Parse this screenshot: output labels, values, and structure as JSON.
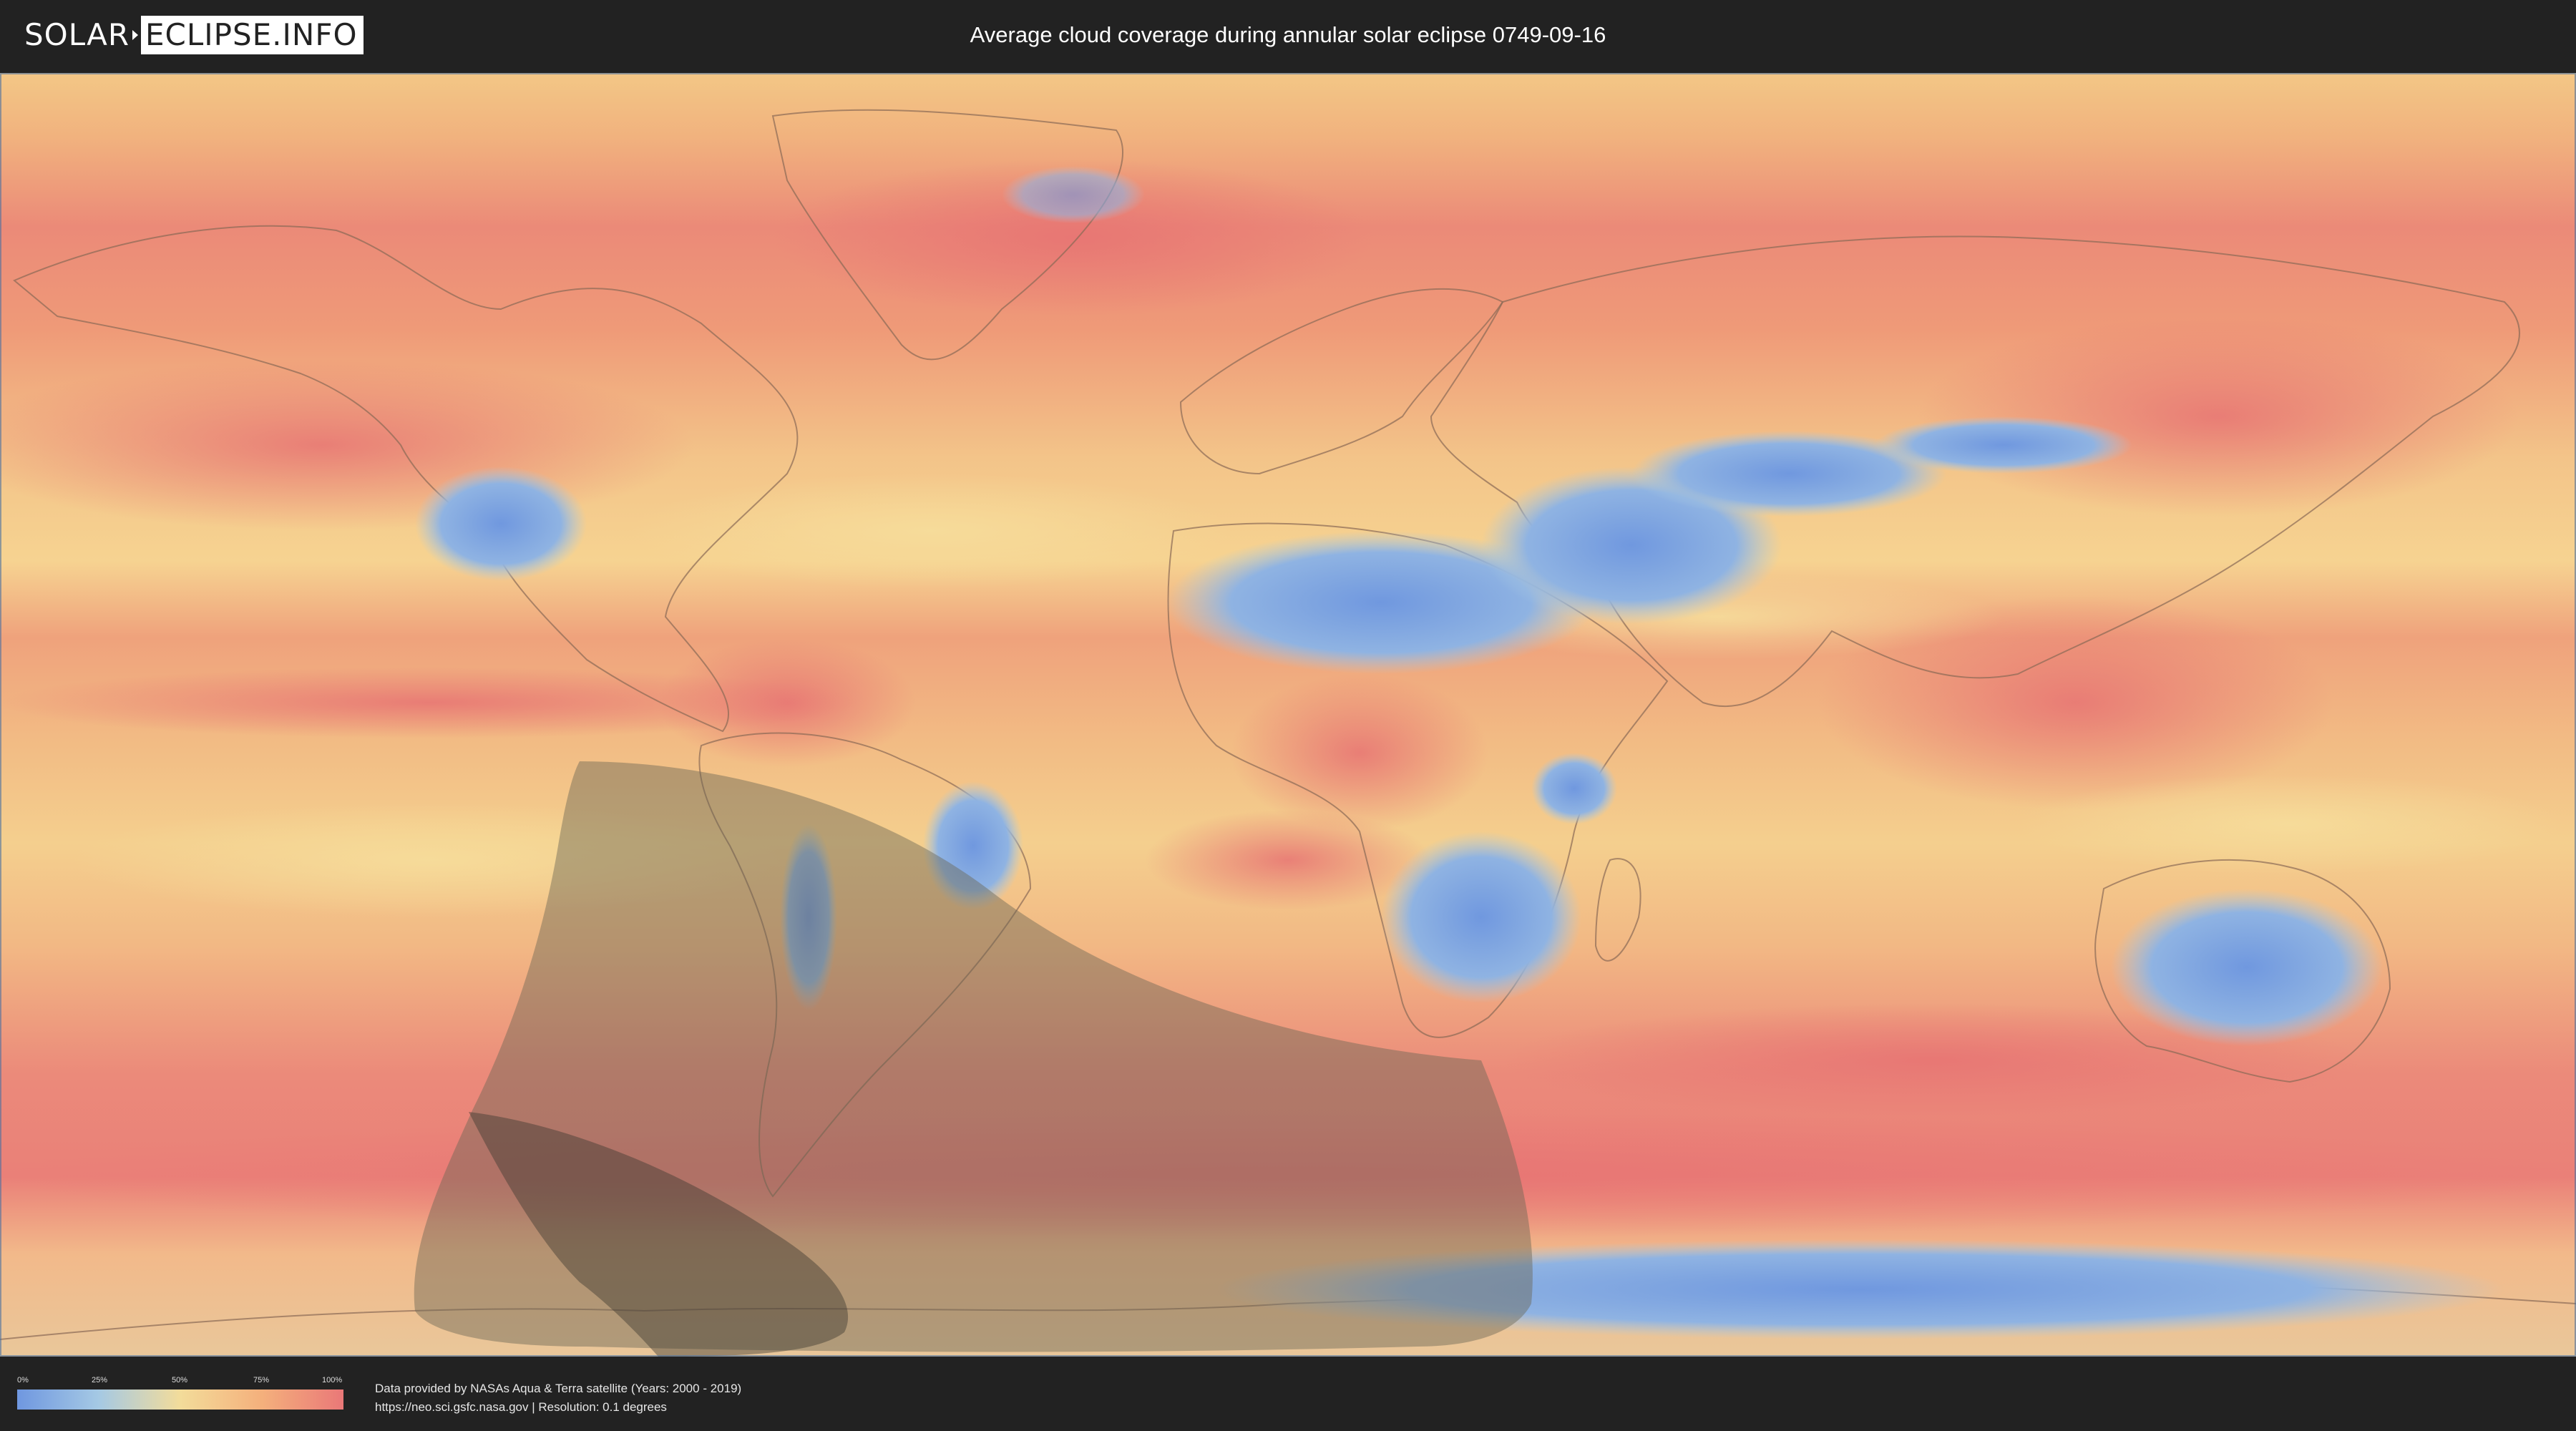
{
  "header": {
    "logo_part1": "SOLAR",
    "logo_part2": "ECLIPSE.INFO",
    "title": "Average cloud coverage during annular solar eclipse 0749-09-16"
  },
  "map": {
    "colors": {
      "clear": "#6f97e0",
      "light": "#a5c9e4",
      "mid": "#f3dc9a",
      "heavy": "#f4b07c",
      "overcast": "#ea7878",
      "eclipse_penumbra": "#6b6555",
      "eclipse_path": "#3f3a30",
      "borders": "#8a6a55"
    }
  },
  "legend": {
    "ticks": [
      "0%",
      "25%",
      "50%",
      "75%",
      "100%"
    ]
  },
  "footer": {
    "credit_line1": "Data provided by NASAs Aqua & Terra satellite (Years: 2000 - 2019)",
    "credit_line2": "https://neo.sci.gsfc.nasa.gov | Resolution: 0.1 degrees"
  }
}
